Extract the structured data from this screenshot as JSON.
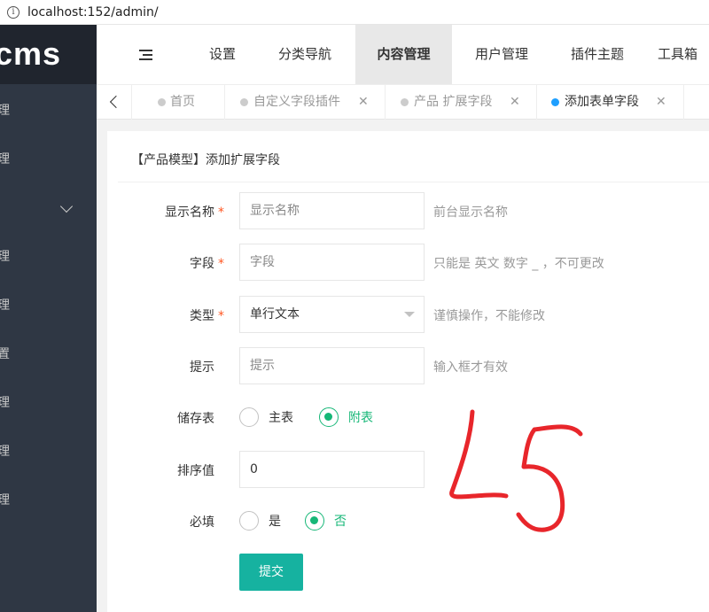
{
  "browser": {
    "url": "localhost:152/admin/"
  },
  "sidebar": {
    "logo_text": "cms",
    "items": [
      {
        "label": "理"
      },
      {
        "label": "理"
      },
      {
        "label": ""
      },
      {
        "label": "理"
      },
      {
        "label": "理"
      },
      {
        "label": "置"
      },
      {
        "label": "理"
      },
      {
        "label": "理"
      },
      {
        "label": "理"
      }
    ]
  },
  "top_nav": {
    "items": [
      {
        "label": "设置"
      },
      {
        "label": "分类导航"
      },
      {
        "label": "内容管理"
      },
      {
        "label": "用户管理"
      },
      {
        "label": "插件主题"
      },
      {
        "label": "工具箱"
      }
    ],
    "active": "内容管理"
  },
  "tabs": [
    {
      "label": "首页",
      "closable": false
    },
    {
      "label": "自定义字段插件",
      "closable": true
    },
    {
      "label": "产品 扩展字段",
      "closable": true
    },
    {
      "label": "添加表单字段",
      "closable": true,
      "active": true
    }
  ],
  "form": {
    "title": "【产品模型】添加扩展字段",
    "fields": {
      "display_name": {
        "label": "显示名称",
        "placeholder": "显示名称",
        "hint": "前台显示名称"
      },
      "field": {
        "label": "字段",
        "placeholder": "字段",
        "hint": "只能是 英文 数字 _ ，不可更改"
      },
      "type": {
        "label": "类型",
        "value": "单行文本",
        "hint": "谨慎操作，不能修改"
      },
      "tip": {
        "label": "提示",
        "placeholder": "提示",
        "hint": "输入框才有效"
      },
      "storage": {
        "label": "储存表",
        "options": [
          "主表",
          "附表"
        ],
        "selected": "附表"
      },
      "sort": {
        "label": "排序值",
        "value": "0"
      },
      "required": {
        "label": "必填",
        "options": [
          "是",
          "否"
        ],
        "selected": "否"
      }
    },
    "submit_label": "提交"
  },
  "colors": {
    "sidebar_bg": "#2f3744",
    "accent_green": "#16b777",
    "button_teal": "#16b2a0",
    "active_tab_dot": "#1e9fff",
    "scribble_red": "#e8262b"
  }
}
